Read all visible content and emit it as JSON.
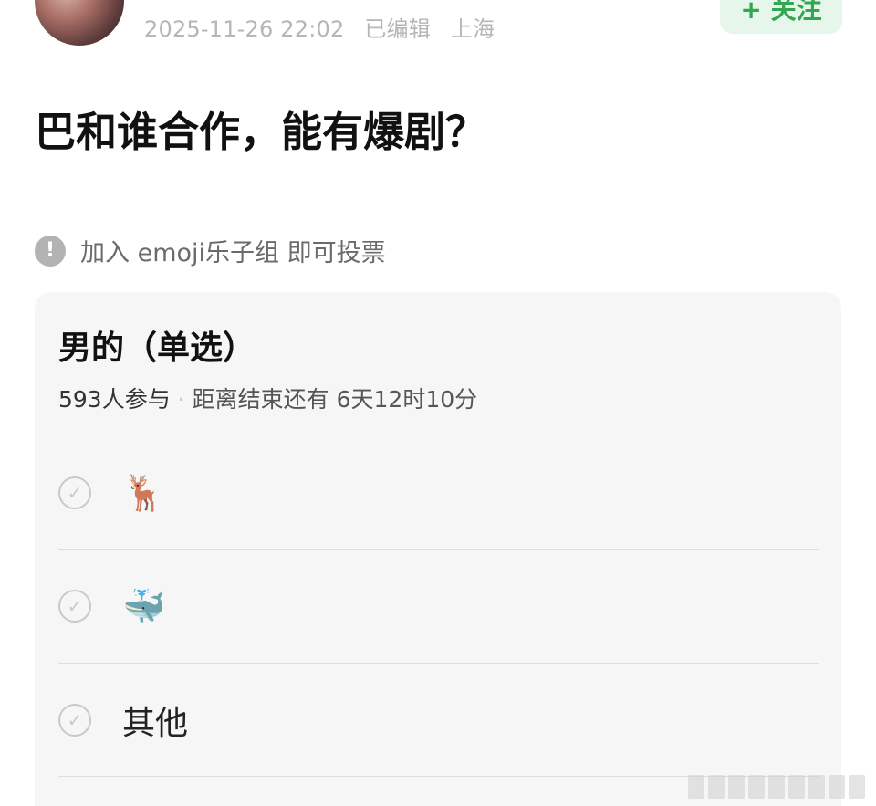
{
  "header": {
    "timestamp": "2025-11-26 22:02",
    "edited": "已编辑",
    "location": "上海",
    "follow_label": "+ 关注"
  },
  "post": {
    "title": "巴和谁合作，能有爆剧？"
  },
  "notice": {
    "icon": "exclamation-icon",
    "text": "加入 emoji乐子组 即可投票"
  },
  "poll": {
    "title": "男的（单选）",
    "participants": "593人参与",
    "separator": "·",
    "remaining": "距离结束还有 6天12时10分",
    "options": [
      {
        "label": "🦌",
        "icon": "deer-emoji"
      },
      {
        "label": "🐳",
        "icon": "whale-emoji"
      },
      {
        "label": "其他",
        "icon": ""
      }
    ],
    "check_glyph": "✓"
  },
  "colors": {
    "accent_green": "#2fa84f",
    "follow_bg": "#e6f6ea",
    "card_bg": "#f6f6f6",
    "muted_text": "#b6b6b6"
  }
}
